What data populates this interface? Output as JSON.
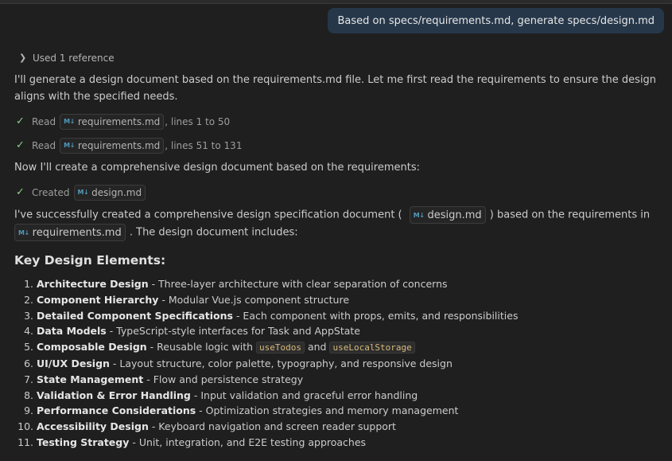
{
  "user_message": "Based on specs/requirements.md, generate specs/design.md",
  "references": {
    "label": "Used 1 reference"
  },
  "intro": "I'll generate a design document based on the requirements.md file. Let me first read the requirements to ensure the design aligns with the specified needs.",
  "tools": [
    {
      "verb": "Read",
      "file": "requirements.md",
      "detail": ", lines 1 to 50"
    },
    {
      "verb": "Read",
      "file": "requirements.md",
      "detail": ", lines 51 to 131"
    }
  ],
  "now_text": "Now I'll create a comprehensive design document based on the requirements:",
  "created": {
    "verb": "Created",
    "file": "design.md"
  },
  "summary": {
    "part1": "I've successfully created a comprehensive design specification document (",
    "file1": "design.md",
    "part2": ") based on the requirements in",
    "file2": "requirements.md",
    "part3": ". The design document includes:"
  },
  "md_icon_text": "M↓",
  "section_title": "Key Design Elements:",
  "items": [
    {
      "title": "Architecture Design",
      "desc": " - Three-layer architecture with clear separation of concerns"
    },
    {
      "title": "Component Hierarchy",
      "desc": " - Modular Vue.js component structure"
    },
    {
      "title": "Detailed Component Specifications",
      "desc": " - Each component with props, emits, and responsibilities"
    },
    {
      "title": "Data Models",
      "desc": " - TypeScript-style interfaces for Task and AppState"
    },
    {
      "title": "Composable Design",
      "desc": " - Reusable logic with ",
      "code1": "useTodos",
      "mid": " and ",
      "code2": "useLocalStorage"
    },
    {
      "title": "UI/UX Design",
      "desc": " - Layout structure, color palette, typography, and responsive design"
    },
    {
      "title": "State Management",
      "desc": " - Flow and persistence strategy"
    },
    {
      "title": "Validation & Error Handling",
      "desc": " - Input validation and graceful error handling"
    },
    {
      "title": "Performance Considerations",
      "desc": " - Optimization strategies and memory management"
    },
    {
      "title": "Accessibility Design",
      "desc": " - Keyboard navigation and screen reader support"
    },
    {
      "title": "Testing Strategy",
      "desc": " - Unit, integration, and E2E testing approaches"
    }
  ]
}
